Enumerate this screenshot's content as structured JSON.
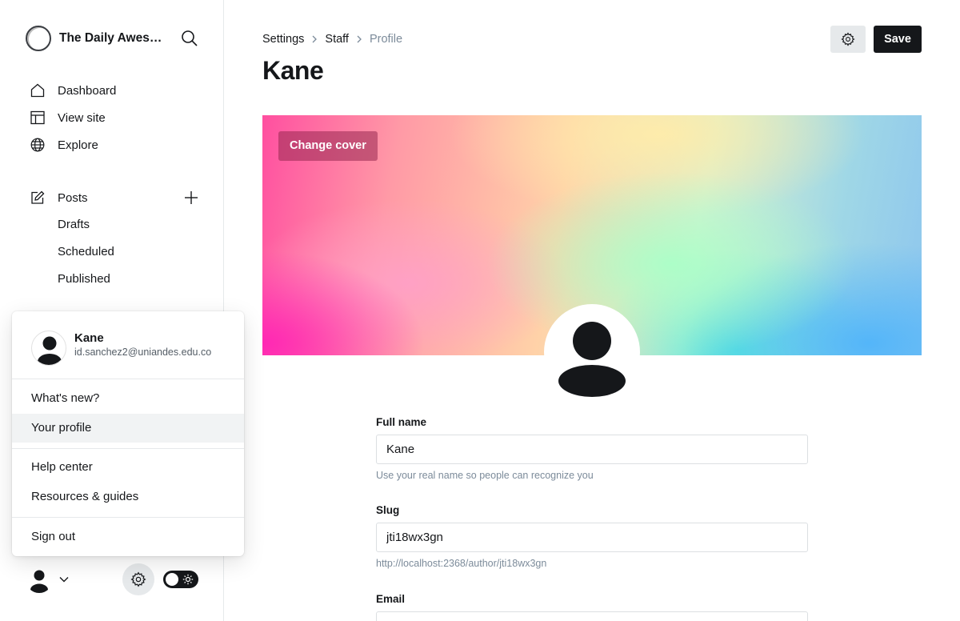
{
  "sidebar": {
    "site_title": "The Daily Awesome",
    "nav": [
      {
        "label": "Dashboard",
        "icon": "home-icon"
      },
      {
        "label": "View site",
        "icon": "layout-icon"
      },
      {
        "label": "Explore",
        "icon": "globe-icon"
      }
    ],
    "posts": {
      "label": "Posts",
      "icon": "edit-icon",
      "sub_items": [
        "Drafts",
        "Scheduled",
        "Published"
      ]
    }
  },
  "user_menu": {
    "name": "Kane",
    "email": "id.sanchez2@uniandes.edu.co",
    "items": [
      "What's new?",
      "Your profile",
      "Help center",
      "Resources & guides",
      "Sign out"
    ],
    "active_item": "Your profile"
  },
  "header": {
    "breadcrumb": [
      "Settings",
      "Staff",
      "Profile"
    ],
    "title": "Kane",
    "save_label": "Save"
  },
  "cover": {
    "change_label": "Change cover"
  },
  "form": {
    "full_name": {
      "label": "Full name",
      "value": "Kane",
      "hint": "Use your real name so people can recognize you"
    },
    "slug": {
      "label": "Slug",
      "value": "jti18wx3gn",
      "hint": "http://localhost:2368/author/jti18wx3gn"
    },
    "email": {
      "label": "Email"
    }
  },
  "colors": {
    "primary": "#15171a",
    "muted": "#7c8b9a",
    "border": "#dcdfe2"
  }
}
